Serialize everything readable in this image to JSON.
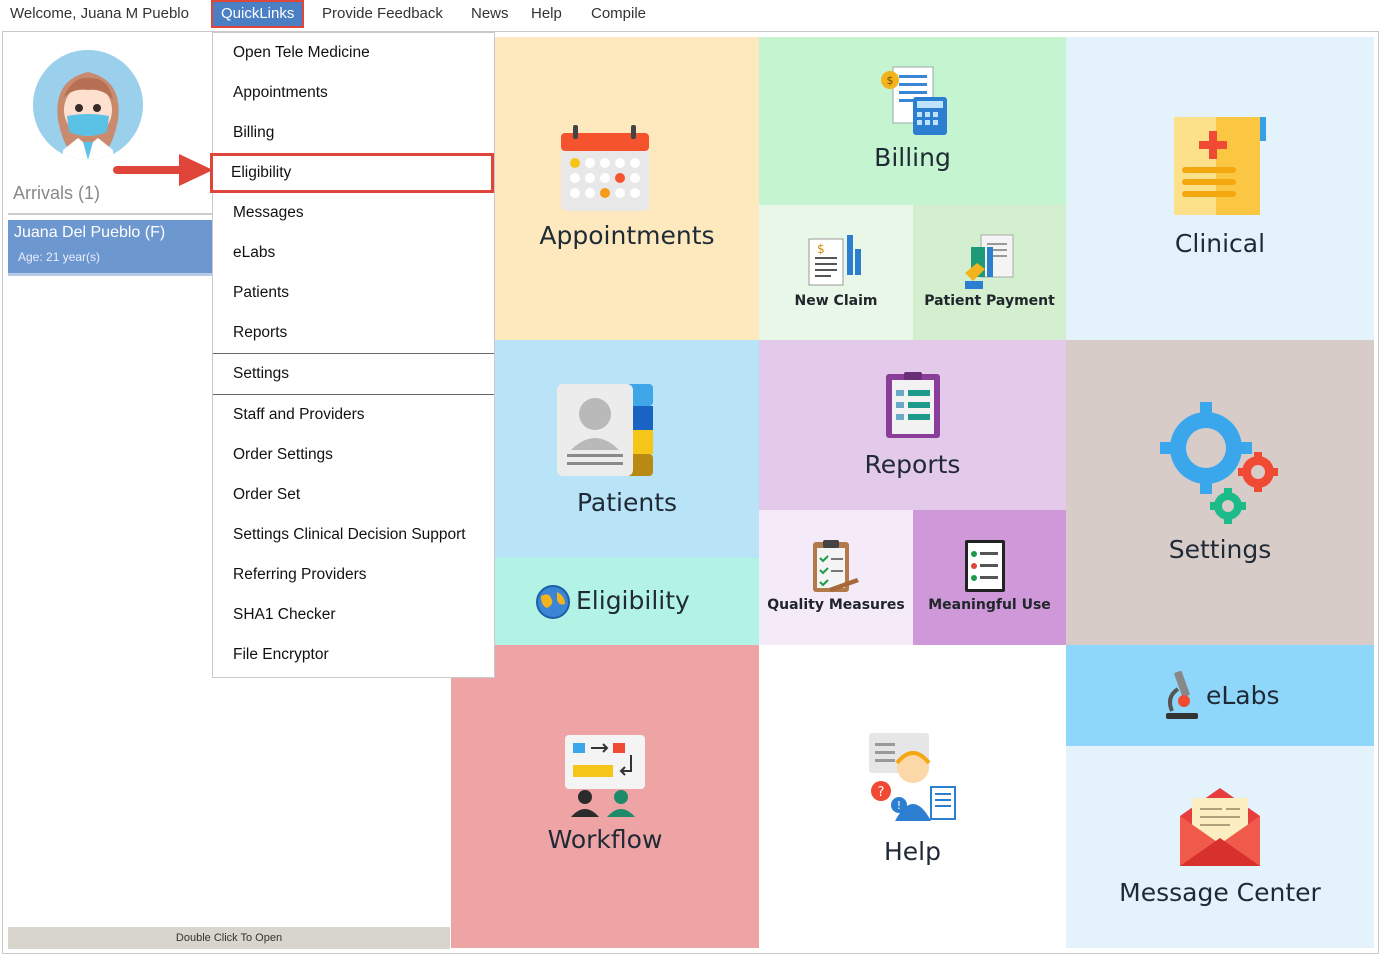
{
  "menubar": {
    "welcome": "Welcome, Juana M Pueblo",
    "quicklinks": "QuickLinks",
    "feedback": "Provide Feedback",
    "news": "News",
    "help": "Help",
    "compile": "Compile"
  },
  "left": {
    "arrivals": "Arrivals (1)",
    "patient_name": "Juana Del Pueblo (F)",
    "patient_age": "Age: 21 year(s)",
    "footer": "Double Click To Open"
  },
  "dropdown": {
    "items": [
      "Open Tele Medicine",
      "Appointments",
      "Billing",
      "Eligibility",
      "Messages",
      "eLabs",
      "Patients",
      "Reports",
      "Settings",
      "Staff and Providers",
      "Order Settings",
      "Order Set",
      "Settings Clinical Decision Support",
      "Referring Providers",
      "SHA1 Checker",
      "File Encryptor"
    ],
    "highlighted": "Eligibility"
  },
  "tiles": {
    "appointments": "Appointments",
    "billing": "Billing",
    "new_claim": "New Claim",
    "patient_payment": "Patient Payment",
    "clinical": "Clinical",
    "patients": "Patients",
    "reports": "Reports",
    "settings": "Settings",
    "eligibility": "Eligibility",
    "quality_measures": "Quality Measures",
    "meaningful_use": "Meaningful Use",
    "elabs": "eLabs",
    "workflow": "Workflow",
    "help": "Help",
    "message_center": "Message Center"
  },
  "colors": {
    "accent": "#4a7fc4",
    "highlight_border": "#e0453a",
    "appointments_bg": "#fde9bd",
    "billing_bg": "#c4f4d0",
    "clinical_bg": "#e4f2fb",
    "patients_bg": "#b9e4f7",
    "reports_bg": "#e3c9ea",
    "settings_bg": "#d8ccc9",
    "eligibility_bg": "#b3f3e5",
    "workflow_bg": "#eea3a5",
    "elabs_bg": "#8fd7fa",
    "message_bg": "#e4f2fb"
  }
}
